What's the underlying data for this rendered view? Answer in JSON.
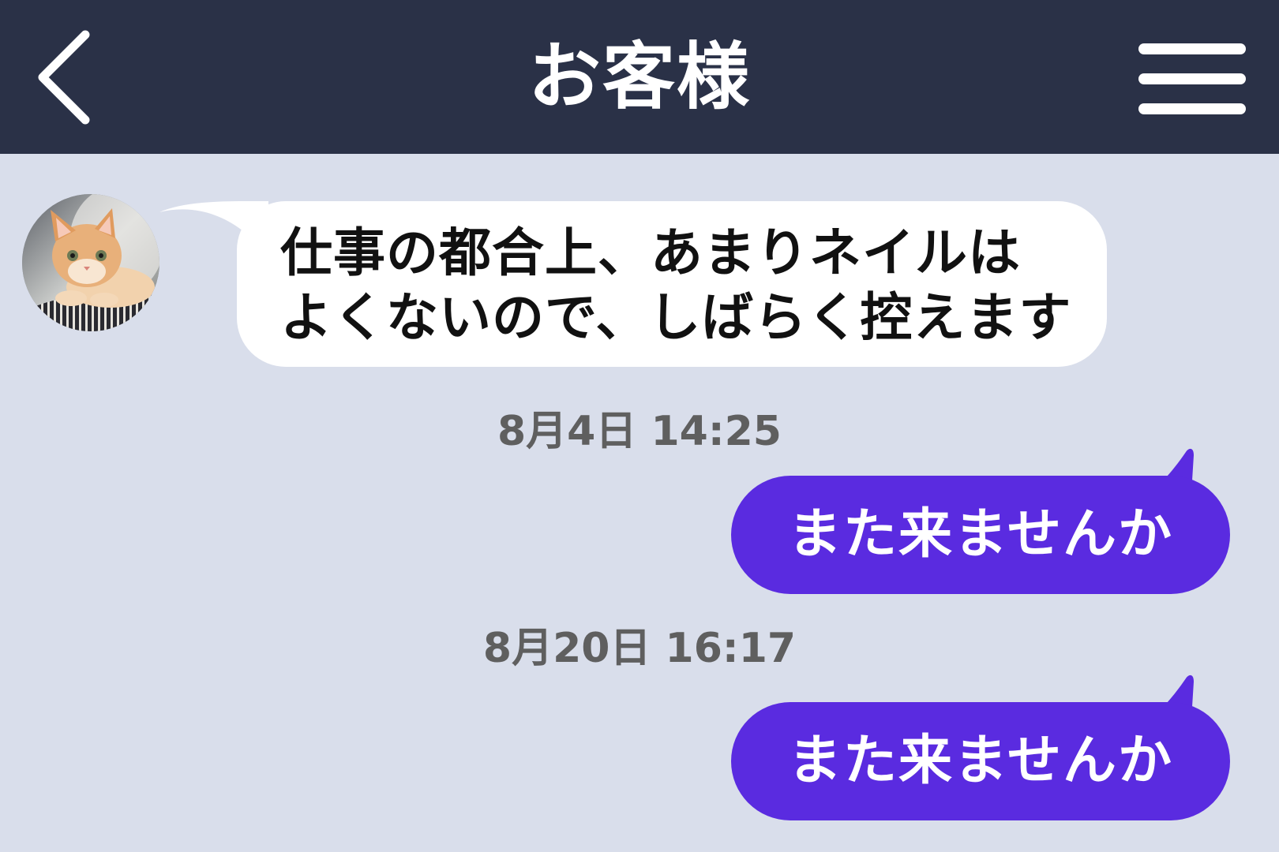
{
  "header": {
    "title": "お客様",
    "back_icon": "chevron-left-icon",
    "menu_icon": "hamburger-menu-icon"
  },
  "colors": {
    "header_bg": "#2a3147",
    "chat_bg": "#d9deeb",
    "incoming_bubble": "#ffffff",
    "outgoing_bubble": "#5a2be0",
    "timestamp_text": "#5f5f5f"
  },
  "messages": [
    {
      "direction": "incoming",
      "lines": [
        "仕事の都合上、あまりネイルは",
        "よくないので、しばらく控えます"
      ]
    },
    {
      "direction": "outgoing",
      "timestamp": "8月4日 14:25",
      "text": "また来ませんか"
    },
    {
      "direction": "outgoing",
      "timestamp": "8月20日 16:17",
      "text": "また来ませんか"
    }
  ]
}
